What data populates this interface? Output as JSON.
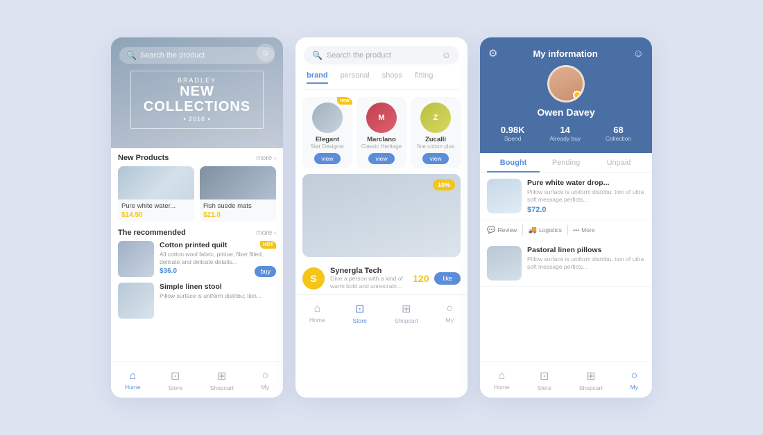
{
  "bg": "#dde3f0",
  "phone1": {
    "search_placeholder": "Search the product",
    "hero": {
      "subtitle": "BRADLEY",
      "title": "NEW\nCOLLECTIONS",
      "year": "• 2016 •"
    },
    "new_products": {
      "label": "New Products",
      "more": "more",
      "items": [
        {
          "name": "Pure white water...",
          "price": "$14.50",
          "price_color": "#f5c518"
        },
        {
          "name": "Fish suede mats",
          "price": "$21.0",
          "price_color": "#f5c518"
        }
      ]
    },
    "recommended": {
      "label": "The recommended",
      "more": "more",
      "items": [
        {
          "name": "Cotton printed quilt",
          "desc": "All cotton wool fabric, pintue, fiber filled, delicate and delicate details...",
          "price": "$36.0",
          "buy": "buy",
          "hot": "HOT"
        },
        {
          "name": "Simple linen stool",
          "desc": "Pillow surface is uniform distribu; tion..."
        }
      ]
    },
    "nav": [
      {
        "label": "Home",
        "icon": "🏠",
        "active": true
      },
      {
        "label": "Store",
        "icon": "🏪",
        "active": false
      },
      {
        "label": "Shopcart",
        "icon": "🛒",
        "active": false
      },
      {
        "label": "My",
        "icon": "👤",
        "active": false
      }
    ]
  },
  "phone2": {
    "search_placeholder": "Search the product",
    "tabs": [
      "brand",
      "personal",
      "shops",
      "fitting"
    ],
    "active_tab": "brand",
    "brands": [
      {
        "name": "Elegant",
        "role": "Star Designer",
        "new": true
      },
      {
        "name": "Marclano",
        "role": "Classic Heritage"
      },
      {
        "name": "Zucalli",
        "role": "fine cotton plus"
      }
    ],
    "brand_view_label": "view",
    "featured": {
      "badge": "10%"
    },
    "brand_info": {
      "name": "Synergla Tech",
      "desc": "Give a person with a kind of warm bold and unrestrain...",
      "count": "120",
      "like_label": "like"
    },
    "nav": [
      {
        "label": "Home",
        "icon": "🏠",
        "active": false
      },
      {
        "label": "Store",
        "icon": "🏪",
        "active": true
      },
      {
        "label": "Shopcart",
        "icon": "🛒",
        "active": false
      },
      {
        "label": "My",
        "icon": "👤",
        "active": false
      }
    ]
  },
  "phone3": {
    "title": "My information",
    "user": {
      "name": "Owen Davey",
      "spend": "0.98K",
      "spend_label": "Spend",
      "already_buy": "14",
      "already_buy_label": "Already buy",
      "collection": "68",
      "collection_label": "Collection"
    },
    "tabs": [
      "Bought",
      "Pending",
      "Unpaid"
    ],
    "active_tab": "Bought",
    "orders": [
      {
        "name": "Pure white water drop...",
        "desc": "Pillow surface is uniform distribu. tion of ultra soft message perficts...",
        "price": "$72.0",
        "actions": [
          "Review",
          "Logistics",
          "More"
        ]
      },
      {
        "name": "Pastoral linen pillows",
        "desc": "Pillow surface is uniform distribu. tion of ultra soft message perficts..."
      }
    ],
    "nav": [
      {
        "label": "Home",
        "icon": "🏠",
        "active": false
      },
      {
        "label": "Store",
        "icon": "🏪",
        "active": false
      },
      {
        "label": "Shopcart",
        "icon": "🛒",
        "active": false
      },
      {
        "label": "My",
        "icon": "👤",
        "active": true
      }
    ]
  }
}
